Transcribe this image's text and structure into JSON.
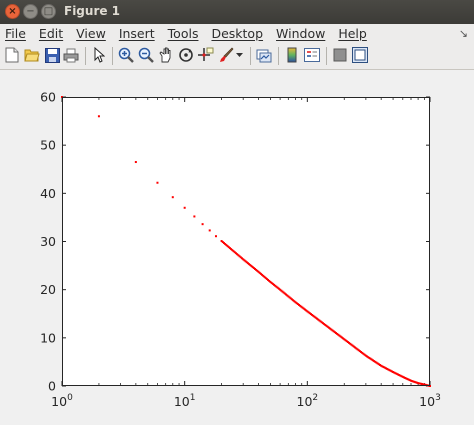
{
  "window": {
    "title": "Figure 1",
    "controls": {
      "close_glyph": "×",
      "minimize_glyph": "−",
      "maximize_glyph": "□"
    }
  },
  "menubar": {
    "items": [
      {
        "label": "File"
      },
      {
        "label": "Edit"
      },
      {
        "label": "View"
      },
      {
        "label": "Insert"
      },
      {
        "label": "Tools"
      },
      {
        "label": "Desktop"
      },
      {
        "label": "Window"
      },
      {
        "label": "Help"
      }
    ],
    "overflow_glyph": "↘"
  },
  "toolbar": {
    "icons": [
      "new-figure-icon",
      "open-file-icon",
      "save-icon",
      "print-icon",
      "edit-plot-icon",
      "zoom-in-icon",
      "zoom-out-icon",
      "pan-icon",
      "rotate-3d-icon",
      "data-cursor-icon",
      "brush-icon",
      "brush-dropdown-icon",
      "link-plot-icon",
      "insert-colorbar-icon",
      "insert-legend-icon",
      "hide-plot-tools-icon",
      "show-plot-tools-icon"
    ]
  },
  "chart_data": {
    "type": "scatter",
    "title": "",
    "xlabel": "",
    "ylabel": "",
    "xscale": "log",
    "xlim": [
      1,
      1000
    ],
    "ylim": [
      0,
      60
    ],
    "xticks": [
      1,
      10,
      100,
      1000
    ],
    "xtick_labels": [
      {
        "base": "10",
        "exp": "0"
      },
      {
        "base": "10",
        "exp": "1"
      },
      {
        "base": "10",
        "exp": "2"
      },
      {
        "base": "10",
        "exp": "3"
      }
    ],
    "yticks": [
      0,
      10,
      20,
      30,
      40,
      50,
      60
    ],
    "ytick_labels": [
      "0",
      "10",
      "20",
      "30",
      "40",
      "50",
      "60"
    ],
    "grid": false,
    "marker_color": "#ff0000",
    "series": [
      {
        "x": [
          1,
          2,
          4,
          6,
          8,
          10,
          12,
          14,
          16,
          18,
          20,
          25,
          30,
          40,
          50,
          60,
          80,
          100,
          150,
          200,
          300,
          400,
          500,
          600,
          700,
          800,
          900,
          1000
        ],
        "y": [
          60,
          56,
          46.5,
          42.2,
          39.2,
          37,
          35.2,
          33.6,
          32.3,
          31.1,
          30.1,
          28,
          26.3,
          23.7,
          21.6,
          20,
          17.4,
          15.5,
          12.1,
          9.7,
          6.3,
          4.2,
          2.9,
          1.9,
          1.1,
          0.6,
          0.3,
          0
        ]
      }
    ]
  }
}
